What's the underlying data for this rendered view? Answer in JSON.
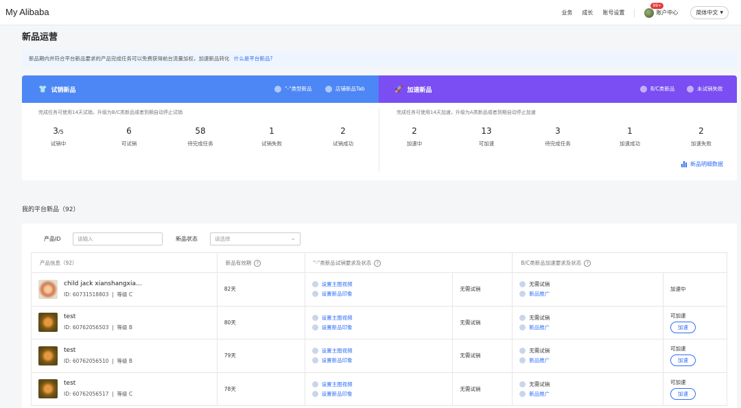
{
  "header": {
    "brand": "My Alibaba",
    "nav": [
      "业务",
      "成长",
      "账号设置"
    ],
    "account_label": "账户中心",
    "badge": "99+",
    "language": "简体中文"
  },
  "page": {
    "title": "新品运营",
    "notice": "新品期内并符合平台新品要求的产品完成任务可以免费获得前台流量加权，加速新品转化",
    "notice_link": "什么是平台新品?"
  },
  "trial": {
    "title": "试销新品",
    "options": [
      "\"-\"类型新品",
      "店铺新品Tab"
    ],
    "description": "完成任务可使用14天试销，升级为B/C类新品或者到期自动停止试销",
    "metrics": [
      {
        "value": "3",
        "suffix": "/5",
        "label": "试销中"
      },
      {
        "value": "6",
        "suffix": "",
        "label": "可试销"
      },
      {
        "value": "58",
        "suffix": "",
        "label": "待完成任务"
      },
      {
        "value": "1",
        "suffix": "",
        "label": "试销失败"
      },
      {
        "value": "2",
        "suffix": "",
        "label": "试销成功"
      }
    ]
  },
  "accelerate": {
    "title": "加速新品",
    "options": [
      "B/C类新品",
      "未试销失败"
    ],
    "description": "完成任务可使用14天加速，升级为A类新品或者到期自动停止加速",
    "metrics": [
      {
        "value": "2",
        "label": "加速中"
      },
      {
        "value": "13",
        "label": "可加速"
      },
      {
        "value": "3",
        "label": "待完成任务"
      },
      {
        "value": "1",
        "label": "加速成功"
      },
      {
        "value": "2",
        "label": "加速失败"
      }
    ],
    "detail_link": "新品明细数据"
  },
  "list": {
    "title": "我的平台新品（92）",
    "filter_id_label": "产品ID",
    "filter_id_placeholder": "请输入",
    "filter_status_label": "新品状态",
    "filter_status_placeholder": "请选择",
    "columns": [
      "产品信息（92）",
      "新品有效期",
      "\"-\"类新品试销要求及状态",
      "B/C类新品加速要求及状态"
    ],
    "rows": [
      {
        "name": "child jack xianshangxia...",
        "id": "ID: 60731518803",
        "grade": "等级 C",
        "validity": "82天",
        "trial_tasks": [
          "设置主图视频",
          "设置新品印象"
        ],
        "trial_status": "无需试销",
        "accel_tasks": [
          "无需试销",
          "新品推广"
        ],
        "accel_status": "加速中",
        "accel_button": ""
      },
      {
        "name": "test",
        "id": "ID: 60762056503",
        "grade": "等级 B",
        "validity": "80天",
        "trial_tasks": [
          "设置主图视频",
          "设置新品印象"
        ],
        "trial_status": "无需试销",
        "accel_tasks": [
          "无需试销",
          "新品推广"
        ],
        "accel_status": "可加速",
        "accel_button": "加速"
      },
      {
        "name": "test",
        "id": "ID: 60762056510",
        "grade": "等级 B",
        "validity": "79天",
        "trial_tasks": [
          "设置主图视频",
          "设置新品印象"
        ],
        "trial_status": "无需试销",
        "accel_tasks": [
          "无需试销",
          "新品推广"
        ],
        "accel_status": "可加速",
        "accel_button": "加速"
      },
      {
        "name": "test",
        "id": "ID: 60762056517",
        "grade": "等级 C",
        "validity": "78天",
        "trial_tasks": [
          "设置主图视频",
          "设置新品印象"
        ],
        "trial_status": "无需试销",
        "accel_tasks": [
          "无需试销",
          "新品推广"
        ],
        "accel_status": "可加速",
        "accel_button": "加速"
      }
    ]
  },
  "colors": {
    "trial_band": "#4d86f5",
    "accel_band": "#7a4ef2",
    "link": "#2c6cf6"
  },
  "icons": {
    "trial": "shirt-icon",
    "accelerate": "rocket-icon",
    "detail": "bar-chart-icon",
    "help": "question-circle-icon"
  }
}
